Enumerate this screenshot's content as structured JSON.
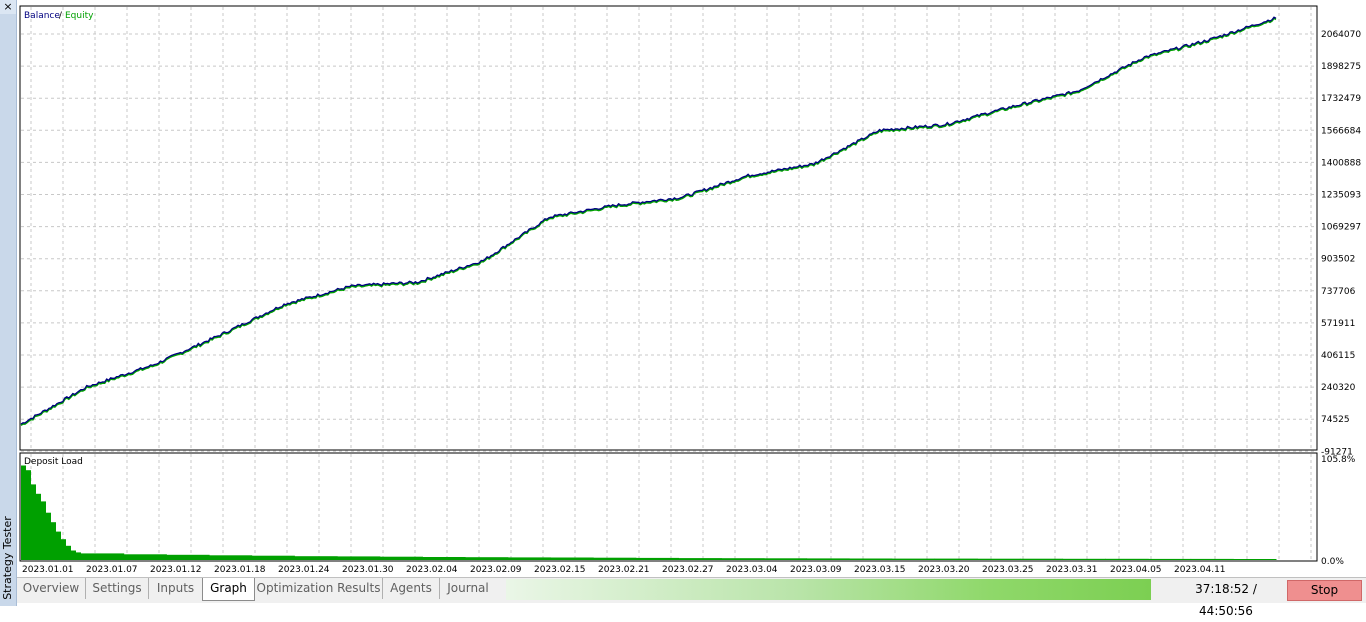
{
  "window": {
    "vertical_title": "Strategy Tester",
    "close_glyph": "×"
  },
  "chart": {
    "legend": {
      "balance_label": "Balance",
      "separator": " / ",
      "equity_label": "Equity"
    },
    "subchart_title": "Deposit Load",
    "colors": {
      "balance": "#000080",
      "equity": "#00a000",
      "deposit_load": "#00a000",
      "grid": "#c8c8c8"
    }
  },
  "chart_data": [
    {
      "type": "line",
      "series": [
        {
          "name": "Balance",
          "color": "#000080"
        },
        {
          "name": "Equity",
          "color": "#00a000"
        }
      ],
      "x": [
        "2023.01.01",
        "2023.01.07",
        "2023.01.12",
        "2023.01.18",
        "2023.01.24",
        "2023.01.30",
        "2023.02.04",
        "2023.02.09",
        "2023.02.15",
        "2023.02.21",
        "2023.02.27",
        "2023.03.04",
        "2023.03.09",
        "2023.03.15",
        "2023.03.20",
        "2023.03.25",
        "2023.03.31",
        "2023.04.05",
        "2023.04.11",
        "2023.04.15"
      ],
      "y_values": [
        40000,
        230000,
        340000,
        490000,
        650000,
        740000,
        760000,
        870000,
        1090000,
        1150000,
        1190000,
        1300000,
        1360000,
        1530000,
        1560000,
        1650000,
        1730000,
        1900000,
        1990000,
        2100000
      ],
      "x_tick_labels": [
        "2023.01.01",
        "2023.01.07",
        "2023.01.12",
        "2023.01.18",
        "2023.01.24",
        "2023.01.30",
        "2023.02.04",
        "2023.02.09",
        "2023.02.15",
        "2023.02.21",
        "2023.02.27",
        "2023.03.04",
        "2023.03.09",
        "2023.03.15",
        "2023.03.20",
        "2023.03.25",
        "2023.03.31",
        "2023.04.05",
        "2023.04.11"
      ],
      "y_tick_labels": [
        "2064070",
        "1898275",
        "1732479",
        "1566684",
        "1400888",
        "1235093",
        "1069297",
        "903502",
        "737706",
        "571911",
        "406115",
        "240320",
        "74525",
        "-91271"
      ],
      "ylim": [
        -91271,
        2180000
      ],
      "grid": true,
      "legend": "top-left"
    },
    {
      "type": "area",
      "title": "Deposit Load",
      "unit": "%",
      "y_tick_labels": [
        "105.8%",
        "0.0%"
      ],
      "ylim": [
        0,
        105.8
      ],
      "x_range": [
        "2023.01.01",
        "2023.04.15"
      ],
      "values": [
        100,
        95,
        80,
        70,
        62,
        50,
        40,
        30,
        22,
        15,
        10,
        8,
        7,
        6,
        5.5,
        5,
        4.5,
        4,
        3.8,
        3.5,
        3.2,
        3,
        2.8,
        2.6,
        2.4,
        2.2,
        2,
        1.9,
        1.8,
        1.7,
        1.6,
        1.5,
        1.5,
        1.4,
        1.4,
        1.3,
        1.3,
        1.2,
        1.2,
        1.1
      ]
    }
  ],
  "tabs": [
    {
      "label": "Overview"
    },
    {
      "label": "Settings"
    },
    {
      "label": "Inputs"
    },
    {
      "label": "Graph"
    },
    {
      "label": "Optimization Results"
    },
    {
      "label": "Agents"
    },
    {
      "label": "Journal"
    }
  ],
  "status": {
    "progress": 1.0,
    "timer": "37:18:52 / 44:50:56",
    "stop_label": "Stop"
  }
}
